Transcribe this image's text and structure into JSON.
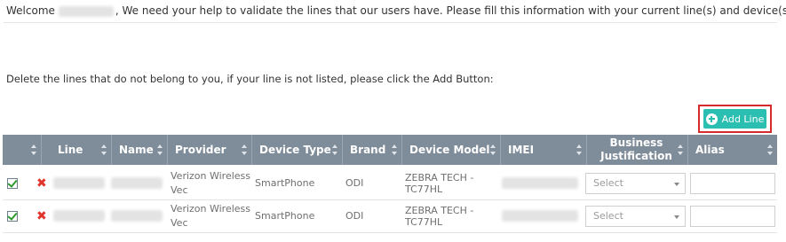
{
  "welcome": {
    "prefix": "Welcome",
    "message": ", We need your help to validate the lines that our users have. Please fill this information with your current line(s) and device(s)."
  },
  "instruction": "Delete the lines that do not belong to you, if your line is not listed, please click the Add Button:",
  "add_button": {
    "label": "Add Line",
    "icon": "plus-circle-icon",
    "color": "#2bbfb1",
    "highlight_color": "#d62b2b"
  },
  "table": {
    "header_color": "#7f8c99",
    "columns": [
      "",
      "Line",
      "Name",
      "Provider",
      "Device Type",
      "Brand",
      "Device Model",
      "IMEI",
      "Business Justification",
      "Alias"
    ],
    "rows": [
      {
        "provider": "Verizon Wireless Vec",
        "device_type": "SmartPhone",
        "brand": "ODI",
        "device_model": "ZEBRA TECH -TC77HL",
        "business_justification": "Select",
        "alias": ""
      },
      {
        "provider": "Verizon Wireless Vec",
        "device_type": "SmartPhone",
        "brand": "ODI",
        "device_model": "ZEBRA TECH -TC77HL",
        "business_justification": "Select",
        "alias": ""
      }
    ]
  }
}
